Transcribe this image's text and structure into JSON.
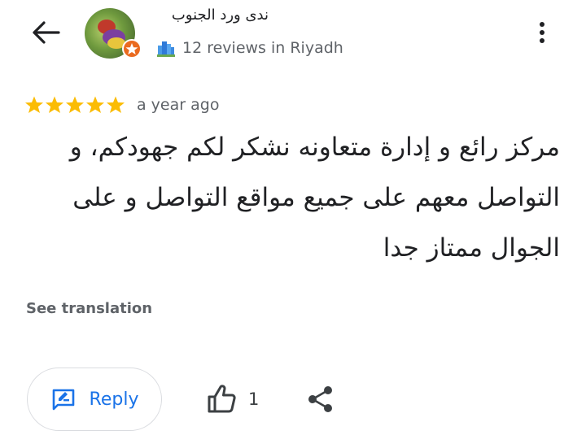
{
  "header": {
    "back_icon": "arrow-left-icon",
    "author_name": "ندى ورد الجنوب",
    "avatar_icon": "bird-avatar",
    "badge_icon": "local-guide-star-icon",
    "reviews_info": "12 reviews in Riyadh",
    "more_icon": "more-vert-icon"
  },
  "review": {
    "rating": 5,
    "rating_max": 5,
    "time_ago": "a year ago",
    "text": "مركز رائع و إدارة متعاونه نشكر لكم جهودكم، و التواصل معهم على  جميع مواقع التواصل و على الجوال ممتاز جدا"
  },
  "actions": {
    "see_translation": "See translation",
    "reply_label": "Reply",
    "reply_icon": "edit-reply-icon",
    "like_icon": "thumb-up-icon",
    "like_count": "1",
    "share_icon": "share-icon"
  },
  "colors": {
    "star": "#fbbc04",
    "accent": "#1a73e8",
    "badge": "#ea6a1f",
    "secondary_text": "#5f6368"
  }
}
